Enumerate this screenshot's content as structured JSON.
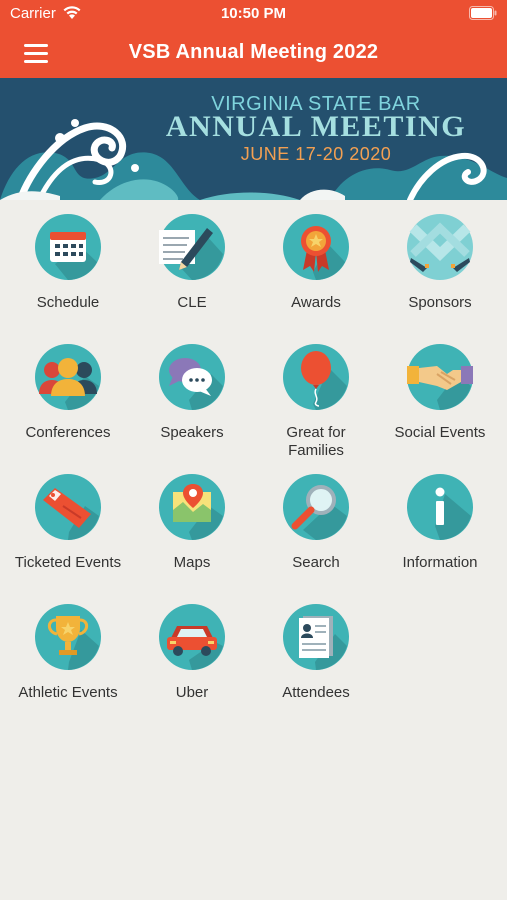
{
  "status_bar": {
    "carrier": "Carrier",
    "time": "10:50 PM"
  },
  "header": {
    "title": "VSB Annual Meeting 2022"
  },
  "banner": {
    "line1": "VIRGINIA STATE BAR",
    "line2": "ANNUAL MEETING",
    "line3": "JUNE 17-20 2020"
  },
  "tiles": [
    {
      "label": "Schedule",
      "icon": "calendar-icon"
    },
    {
      "label": "CLE",
      "icon": "notepad-pencil-icon"
    },
    {
      "label": "Awards",
      "icon": "award-ribbon-icon"
    },
    {
      "label": "Sponsors",
      "icon": "sponsors-icon"
    },
    {
      "label": "Conferences",
      "icon": "people-icon"
    },
    {
      "label": "Speakers",
      "icon": "speech-bubbles-icon"
    },
    {
      "label": "Great for\nFamilies",
      "icon": "balloon-icon"
    },
    {
      "label": "Social Events",
      "icon": "handshake-icon"
    },
    {
      "label": "Ticketed Events",
      "icon": "ticket-icon"
    },
    {
      "label": "Maps",
      "icon": "map-pin-icon"
    },
    {
      "label": "Search",
      "icon": "magnifier-icon"
    },
    {
      "label": "Information",
      "icon": "info-icon"
    },
    {
      "label": "Athletic Events",
      "icon": "trophy-icon"
    },
    {
      "label": "Uber",
      "icon": "car-icon"
    },
    {
      "label": "Attendees",
      "icon": "attendee-card-icon"
    }
  ],
  "colors": {
    "accent": "#ec5032",
    "banner": "#24506e",
    "icon_circle": "#3fb3b5",
    "background": "#efeeea"
  }
}
